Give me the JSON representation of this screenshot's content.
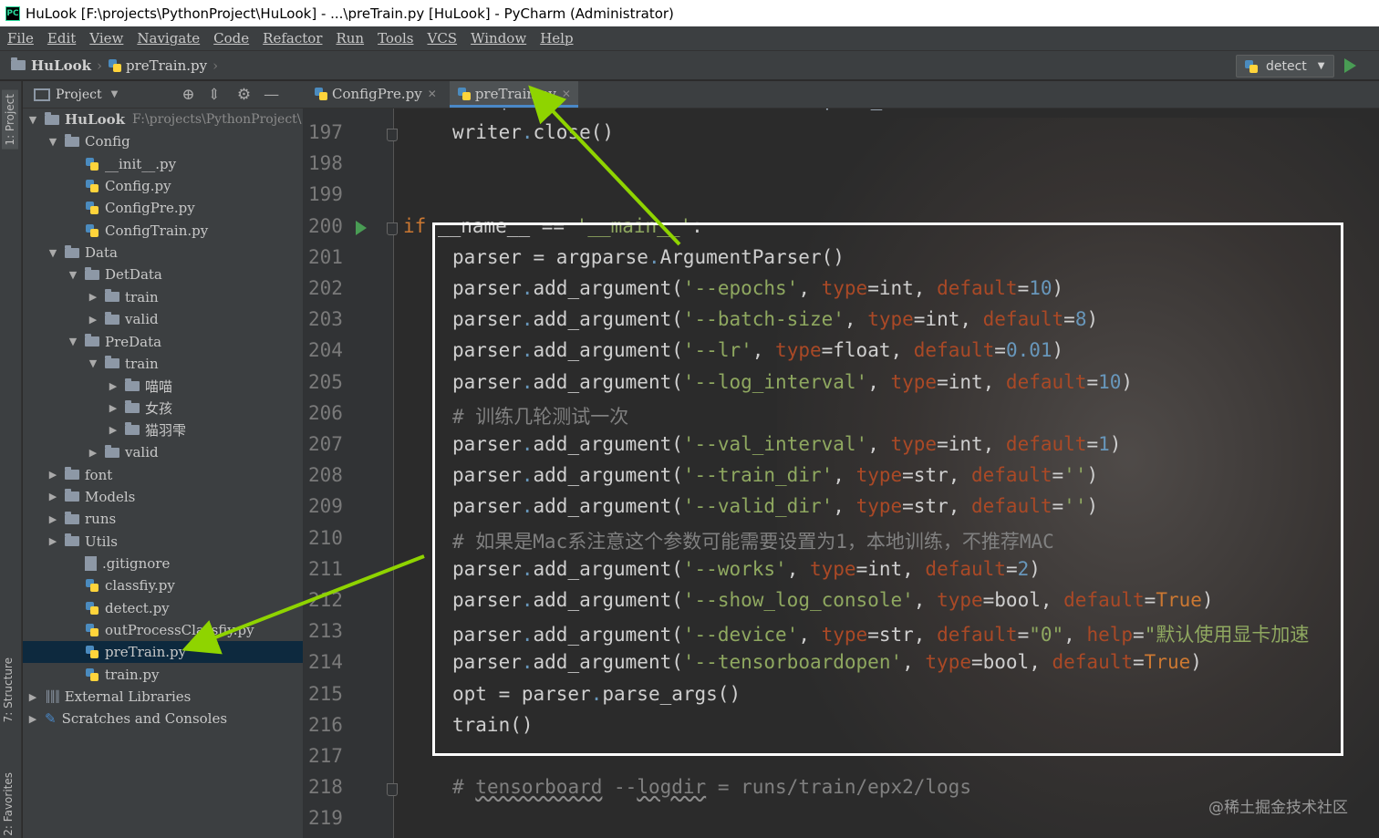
{
  "window": {
    "app_icon_text": "PC",
    "title": "HuLook [F:\\projects\\PythonProject\\HuLook] - ...\\preTrain.py [HuLook] - PyCharm (Administrator)"
  },
  "menu": [
    "File",
    "Edit",
    "View",
    "Navigate",
    "Code",
    "Refactor",
    "Run",
    "Tools",
    "VCS",
    "Window",
    "Help"
  ],
  "breadcrumb": {
    "project": "HuLook",
    "file": "preTrain.py"
  },
  "run_config": {
    "label": "detect"
  },
  "side_tabs": {
    "project": "1: Project",
    "structure": "7: Structure",
    "favorites": "2: Favorites"
  },
  "project_panel": {
    "title": "Project",
    "tree": [
      {
        "label": "HuLook",
        "suffix": "F:\\projects\\PythonProject\\",
        "type": "folder",
        "arrow": "▼",
        "bold": true
      },
      {
        "label": "Config",
        "type": "folder",
        "arrow": "▼"
      },
      {
        "label": "__init__.py",
        "type": "py"
      },
      {
        "label": "Config.py",
        "type": "py"
      },
      {
        "label": "ConfigPre.py",
        "type": "py"
      },
      {
        "label": "ConfigTrain.py",
        "type": "py"
      },
      {
        "label": "Data",
        "type": "folder",
        "arrow": "▼"
      },
      {
        "label": "DetData",
        "type": "folder",
        "arrow": "▼"
      },
      {
        "label": "train",
        "type": "folder",
        "arrow": "▶"
      },
      {
        "label": "valid",
        "type": "folder",
        "arrow": "▶"
      },
      {
        "label": "PreData",
        "type": "folder",
        "arrow": "▼"
      },
      {
        "label": "train",
        "type": "folder",
        "arrow": "▼"
      },
      {
        "label": "喵喵",
        "type": "folder",
        "arrow": "▶"
      },
      {
        "label": "女孩",
        "type": "folder",
        "arrow": "▶"
      },
      {
        "label": "猫羽雫",
        "type": "folder",
        "arrow": "▶"
      },
      {
        "label": "valid",
        "type": "folder",
        "arrow": "▶"
      },
      {
        "label": "font",
        "type": "folder",
        "arrow": "▶"
      },
      {
        "label": "Models",
        "type": "folder",
        "arrow": "▶"
      },
      {
        "label": "runs",
        "type": "folder",
        "arrow": "▶"
      },
      {
        "label": "Utils",
        "type": "folder",
        "arrow": "▶"
      },
      {
        "label": ".gitignore",
        "type": "file"
      },
      {
        "label": "classfiy.py",
        "type": "py"
      },
      {
        "label": "detect.py",
        "type": "py"
      },
      {
        "label": "outProcessClassfiy.py",
        "type": "py"
      },
      {
        "label": "preTrain.py",
        "type": "py",
        "selected": true
      },
      {
        "label": "train.py",
        "type": "py"
      },
      {
        "label": "External Libraries",
        "type": "lib",
        "arrow": "▶"
      },
      {
        "label": "Scratches and Consoles",
        "type": "scratch",
        "arrow": "▶"
      }
    ]
  },
  "editor": {
    "tabs": [
      {
        "label": "ConfigPre.py",
        "active": false
      },
      {
        "label": "preTrain.py",
        "active": true
      }
    ],
    "partial_top_line": "print('tensorboard dir is', path_board)",
    "lines": [
      {
        "n": "197",
        "html": "writer.close()"
      },
      {
        "n": "198",
        "html": ""
      },
      {
        "n": "199",
        "html": ""
      },
      {
        "n": "200",
        "html": "if __name__ == '__main__':"
      },
      {
        "n": "201",
        "html": "parser = argparse.ArgumentParser()"
      },
      {
        "n": "202",
        "html": "parser.add_argument('--epochs', type=int, default=10)"
      },
      {
        "n": "203",
        "html": "parser.add_argument('--batch-size', type=int, default=8)"
      },
      {
        "n": "204",
        "html": "parser.add_argument('--lr', type=float, default=0.01)"
      },
      {
        "n": "205",
        "html": "parser.add_argument('--log_interval', type=int, default=10)"
      },
      {
        "n": "206",
        "html": "# 训练几轮测试一次"
      },
      {
        "n": "207",
        "html": "parser.add_argument('--val_interval', type=int, default=1)"
      },
      {
        "n": "208",
        "html": "parser.add_argument('--train_dir', type=str, default='')"
      },
      {
        "n": "209",
        "html": "parser.add_argument('--valid_dir', type=str, default='')"
      },
      {
        "n": "210",
        "html": "# 如果是Mac系注意这个参数可能需要设置为1，本地训练，不推荐MAC"
      },
      {
        "n": "211",
        "html": "parser.add_argument('--works', type=int, default=2)"
      },
      {
        "n": "212",
        "html": "parser.add_argument('--show_log_console', type=bool, default=True)"
      },
      {
        "n": "213",
        "html": "parser.add_argument('--device', type=str, default=\"0\", help=\"默认使用显卡加速"
      },
      {
        "n": "214",
        "html": "parser.add_argument('--tensorboardopen', type=bool, default=True)"
      },
      {
        "n": "215",
        "html": "opt = parser.parse_args()"
      },
      {
        "n": "216",
        "html": "train()"
      },
      {
        "n": "217",
        "html": ""
      },
      {
        "n": "218",
        "html": "# tensorboard --logdir = runs/train/epx2/logs"
      },
      {
        "n": "219",
        "html": ""
      }
    ]
  },
  "watermark": "@稀土掘金技术社区",
  "colors": {
    "keyword": "#cc7832",
    "string": "#8fa860",
    "number": "#6897bb",
    "kwarg": "#aa4926",
    "comment": "#808080",
    "arrow": "#8fd400"
  }
}
